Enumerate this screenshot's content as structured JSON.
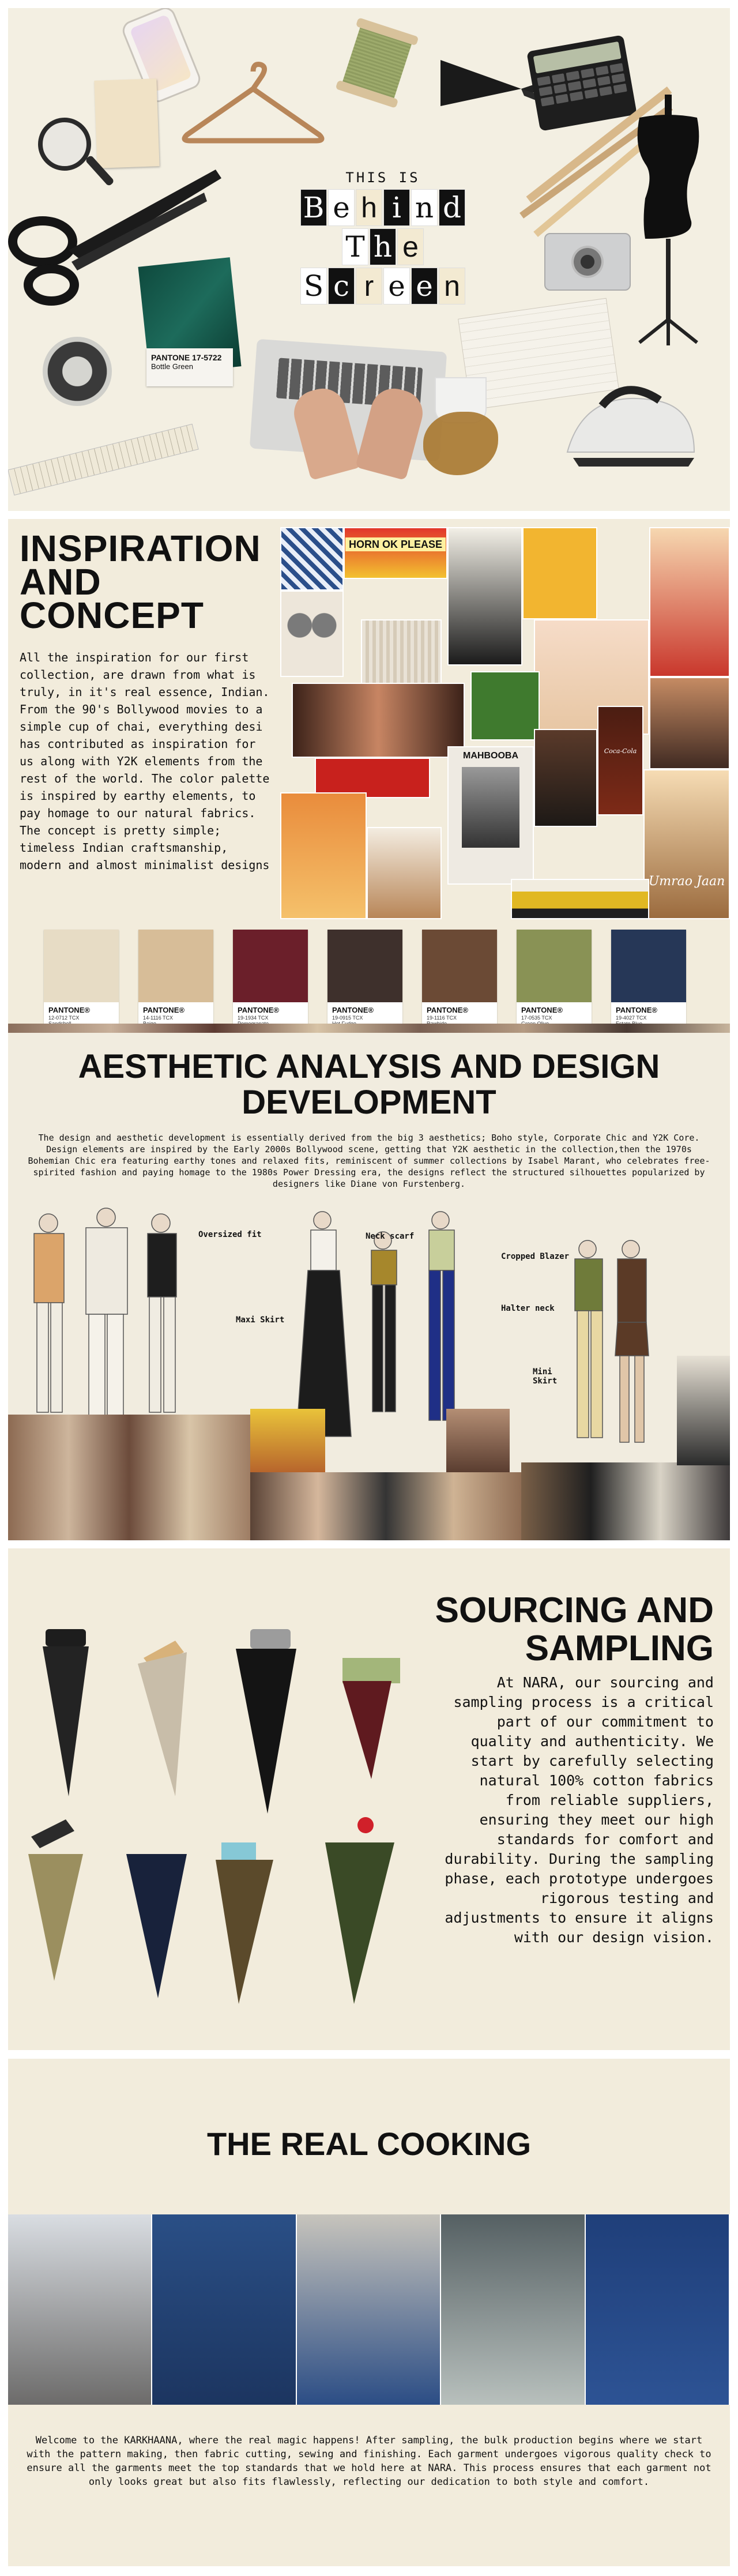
{
  "hero": {
    "small_title": "THIS IS",
    "word1": [
      "B",
      "e",
      "h",
      "i",
      "n",
      "d"
    ],
    "word2": [
      "T",
      "h",
      "e"
    ],
    "word3": [
      "S",
      "c",
      "r",
      "e",
      "e",
      "n"
    ],
    "pantone_label": "PANTONE 17-5722",
    "pantone_sub": "Bottle Green"
  },
  "inspiration": {
    "title_lines": [
      "INSPIRATION",
      "AND",
      "CONCEPT"
    ],
    "body": "All the inspiration for our first collection, are drawn from what is truly, in it's real essence, Indian. From the 90's Bollywood movies to a simple cup of chai, everything desi has contributed as inspiration for us along with Y2K elements from the rest of the world. The color palette is inspired by earthy elements, to pay homage to our natural fabrics. The concept is pretty simple; timeless Indian craftsmanship, modern and almost minimalist designs",
    "collage_texts": {
      "sign": "HORN OK PLEASE",
      "poster_title": "MAHBOOBA",
      "umrao": "Umrao Jaan",
      "cola": "Coca-Cola"
    },
    "swatches": [
      {
        "brand": "PANTONE®",
        "code": "12-0712 TCX",
        "name": "Sandshell",
        "color": "#e7dcc5"
      },
      {
        "brand": "PANTONE®",
        "code": "14-1116 TCX",
        "name": "Beige",
        "color": "#d7bd98"
      },
      {
        "brand": "PANTONE®",
        "code": "19-1934 TCX",
        "name": "Pomegranate",
        "color": "#6b1f2a"
      },
      {
        "brand": "PANTONE®",
        "code": "19-0915 TCX",
        "name": "Hot Fudge",
        "color": "#3e302c"
      },
      {
        "brand": "PANTONE®",
        "code": "19-1116 TCX",
        "name": "Rawhide",
        "color": "#6b4a35"
      },
      {
        "brand": "PANTONE®",
        "code": "17-0535 TCX",
        "name": "Green Olive",
        "color": "#899255"
      },
      {
        "brand": "PANTONE®",
        "code": "19-4027 TCX",
        "name": "Estate Blue",
        "color": "#263757"
      }
    ]
  },
  "aesthetic": {
    "title_lines": [
      "AESTHETIC ANALYSIS AND DESIGN",
      "DEVELOPMENT"
    ],
    "body": "The design and aesthetic development is essentially derived from the big 3 aesthetics; Boho style, Corporate Chic and Y2K Core. Design elements are inspired by the Early 2000s Bollywood scene, getting that Y2K aesthetic in the collection,then the 1970s Bohemian Chic era featuring earthy tones and relaxed fits, reminiscent of summer collections by Isabel Marant, who celebrates free-spirited fashion and paying homage to the 1980s Power Dressing era, the designs reflect the structured silhouettes popularized by designers like Diane von Furstenberg.",
    "annotations": {
      "oversized": "Oversized fit",
      "neck_scarf": "Neck scarf",
      "cropped_blazer": "Cropped Blazer",
      "maxi_skirt": "Maxi Skirt",
      "halter_neck": "Halter neck",
      "mini_skirt": "Mini\nSkirt"
    }
  },
  "sourcing": {
    "title_lines": [
      "SOURCING AND",
      "SAMPLING"
    ],
    "body": "At NARA, our sourcing and sampling process is a critical part of our commitment to quality and authenticity. We start by carefully selecting natural 100% cotton fabrics from reliable suppliers, ensuring they meet our high standards for comfort and durability. During the sampling phase, each prototype undergoes rigorous testing and adjustments to ensure it aligns with our design vision."
  },
  "cooking": {
    "title": "THE REAL COOKING",
    "body": "Welcome to the KARKHAANA, where the real magic happens! After sampling, the bulk production begins where we start with the pattern making, then fabric cutting, sewing and finishing. Each garment undergoes vigorous quality check to ensure all the garments meet the top standards that we hold here at NARA. This process ensures that each garment not only looks great but also fits flawlessly, reflecting our dedication to both style and comfort."
  }
}
